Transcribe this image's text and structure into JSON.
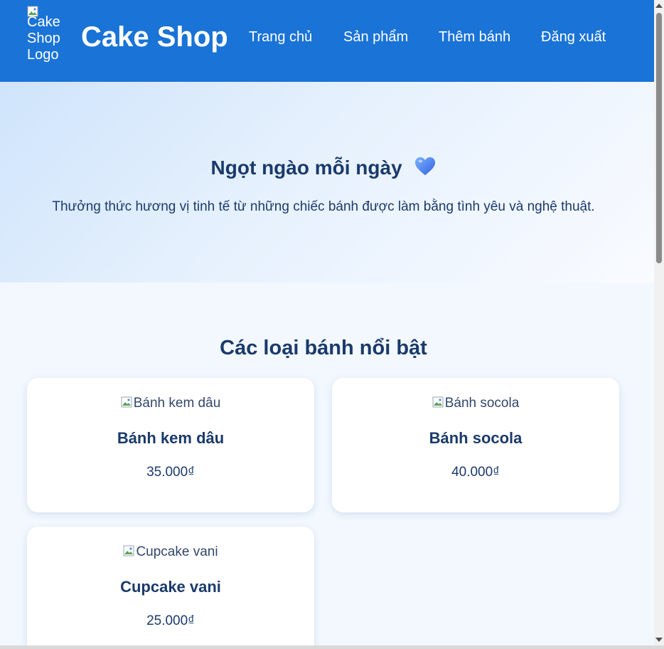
{
  "header": {
    "logo_alt_lines": [
      "Cake",
      "Shop",
      "Logo"
    ],
    "brand": "Cake Shop",
    "nav": {
      "home": "Trang chủ",
      "products": "Sản phẩm",
      "add_cake": "Thêm bánh",
      "logout": "Đăng xuất"
    },
    "background_color": "#1a73d6"
  },
  "hero": {
    "title": "Ngọt ngào mỗi ngày",
    "icon": "blue-heart-icon",
    "subtitle": "Thưởng thức hương vị tinh tế từ những chiếc bánh được làm bằng tình yêu và nghệ thuật."
  },
  "featured": {
    "title": "Các loại bánh nổi bật",
    "products": [
      {
        "image_alt": "Bánh kem dâu",
        "name": "Bánh kem dâu",
        "price": "35.000₫"
      },
      {
        "image_alt": "Bánh socola",
        "name": "Bánh socola",
        "price": "40.000₫"
      },
      {
        "image_alt": "Cupcake vani",
        "name": "Cupcake vani",
        "price": "25.000₫"
      }
    ]
  },
  "colors": {
    "primary": "#1a73d6",
    "heading_text": "#1b3a6b",
    "card_bg": "#ffffff"
  }
}
